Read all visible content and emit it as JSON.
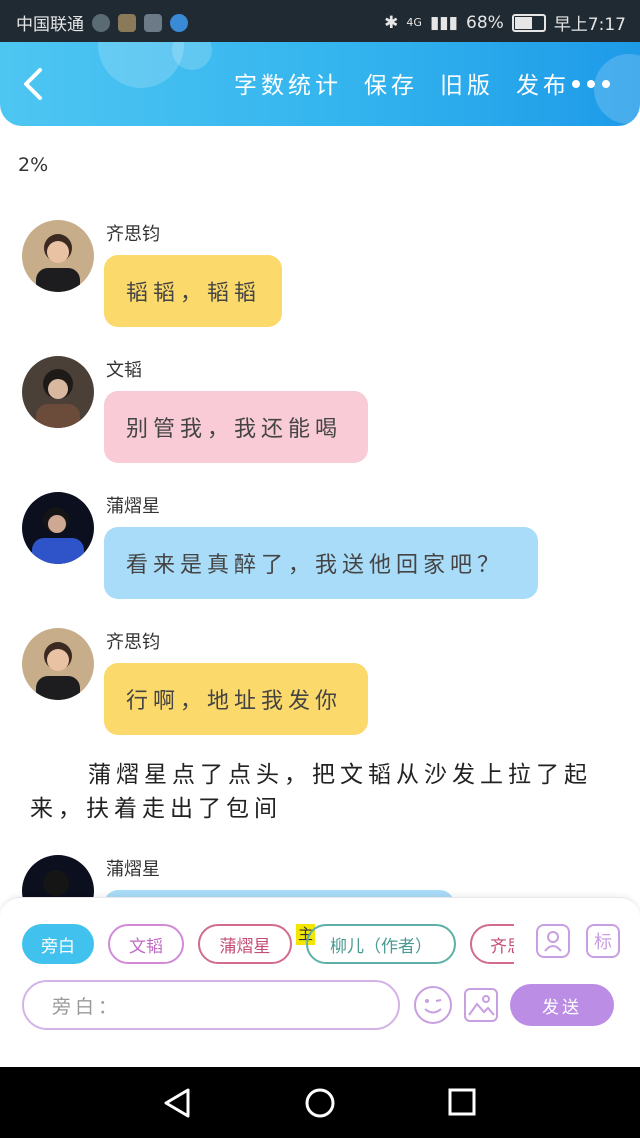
{
  "status_bar": {
    "carrier": "中国联通",
    "network": "4G",
    "battery": "68%",
    "battery_fraction": 0.68,
    "time": "早上7:17"
  },
  "header": {
    "actions": [
      "字数统计",
      "保存",
      "旧版",
      "发布"
    ],
    "back_icon": "chevron-left-icon",
    "more_icon": "more-dots-icon"
  },
  "progress_text": "2%",
  "messages": [
    {
      "name": "齐思钧",
      "text": "韬韬，韬韬",
      "color": "#fcd96b"
    },
    {
      "name": "文韬",
      "text": "别管我，我还能喝",
      "color": "#f8cbd6"
    },
    {
      "name": "蒲熠星",
      "text": "看来是真醉了，我送他回家吧？",
      "color": "#a9dcf8"
    },
    {
      "name": "齐思钧",
      "text": "行啊，地址我发你",
      "color": "#fcd96b"
    }
  ],
  "narration": "蒲熠星点了点头，把文韬从沙发上拉了起来，扶着走出了包间",
  "partial_message": {
    "name": "蒲熠星"
  },
  "panel": {
    "chips": [
      "旁白",
      "文韬",
      "蒲熠星",
      "柳儿（作者）",
      "齐思钧"
    ],
    "main_tag": "主",
    "role_icon_label": "person-icon",
    "tag_icon_label": "标",
    "input_placeholder": "旁白：",
    "send_label": "发送"
  },
  "colors": {
    "accent": "#33b4ee",
    "purple": "#bb8de4"
  }
}
